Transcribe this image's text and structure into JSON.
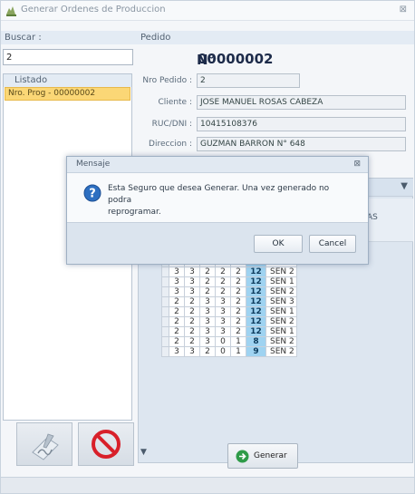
{
  "window": {
    "title": "Generar Ordenes de Produccion",
    "close_glyph": "⊠"
  },
  "left": {
    "buscar_label": "Buscar :",
    "search_value": "2",
    "listado_label": "Listado",
    "list_items": [
      "Nro. Prog - 00000002"
    ]
  },
  "pedido": {
    "header": "Pedido",
    "n_label": "N°",
    "n_value": "00000002",
    "fields": [
      {
        "label": "Nro Pedido :",
        "value": "2"
      },
      {
        "label": "Cliente :",
        "value": "JOSE MANUEL ROSAS CABEZA"
      },
      {
        "label": "RUC/DNI :",
        "value": "10415108376"
      },
      {
        "label": "Direccion :",
        "value": "GUZMAN BARRON N° 648"
      }
    ]
  },
  "grid": {
    "header_fragment": "AS",
    "rows": [
      [
        "3",
        "3",
        "2",
        "2",
        "2",
        "12",
        "SEN 2"
      ],
      [
        "3",
        "3",
        "2",
        "2",
        "2",
        "12",
        "SEN 2"
      ],
      [
        "3",
        "3",
        "2",
        "2",
        "2",
        "12",
        "SEN 1"
      ],
      [
        "3",
        "3",
        "2",
        "2",
        "2",
        "12",
        "SEN 2"
      ],
      [
        "2",
        "2",
        "3",
        "3",
        "2",
        "12",
        "SEN 3"
      ],
      [
        "2",
        "2",
        "3",
        "3",
        "2",
        "12",
        "SEN 1"
      ],
      [
        "2",
        "2",
        "3",
        "3",
        "2",
        "12",
        "SEN 2"
      ],
      [
        "2",
        "2",
        "3",
        "3",
        "2",
        "12",
        "SEN 1"
      ],
      [
        "2",
        "2",
        "3",
        "0",
        "1",
        "8",
        "SEN 2"
      ],
      [
        "3",
        "3",
        "2",
        "0",
        "1",
        "9",
        "SEN 2"
      ]
    ]
  },
  "generar_label": "Generar",
  "dialog": {
    "title": "Mensaje",
    "close_glyph": "⊠",
    "message_line1": "Esta Seguro que desea Generar. Una vez generado no podra",
    "message_line2": "reprogramar.",
    "ok_label": "OK",
    "cancel_label": "Cancel"
  }
}
